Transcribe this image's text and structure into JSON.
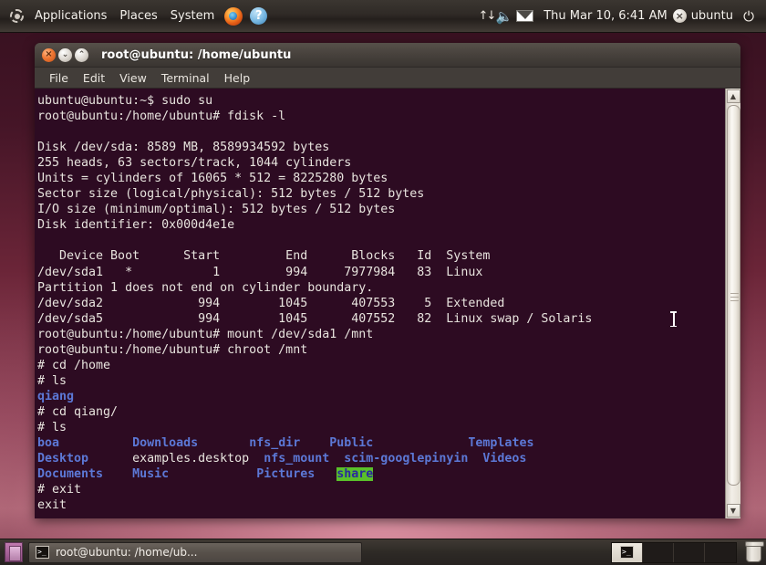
{
  "top_panel": {
    "logo_icon": "ubuntu-logo-icon",
    "menus": [
      "Applications",
      "Places",
      "System"
    ],
    "launchers": [
      {
        "icon": "firefox-icon",
        "label": "Firefox"
      },
      {
        "icon": "help-icon",
        "label": "?"
      }
    ],
    "tray": {
      "network_icon": "network-up-down-icon",
      "volume_icon": "volume-icon",
      "mail_icon": "mail-envelope-icon",
      "clock": "Thu Mar 10,  6:41 AM",
      "user_icon": "user-status-icon",
      "username": "ubuntu",
      "power_icon": "power-icon"
    }
  },
  "window": {
    "title": "root@ubuntu: /home/ubuntu",
    "buttons": {
      "close": "×",
      "minimize": "⌄",
      "maximize": "⌃"
    },
    "menubar": [
      "File",
      "Edit",
      "View",
      "Terminal",
      "Help"
    ]
  },
  "terminal": {
    "lines": [
      [
        {
          "t": "ubuntu@ubuntu:~$ sudo su"
        }
      ],
      [
        {
          "t": "root@ubuntu:/home/ubuntu# fdisk -l"
        }
      ],
      [
        {
          "t": ""
        }
      ],
      [
        {
          "t": "Disk /dev/sda: 8589 MB, 8589934592 bytes"
        }
      ],
      [
        {
          "t": "255 heads, 63 sectors/track, 1044 cylinders"
        }
      ],
      [
        {
          "t": "Units = cylinders of 16065 * 512 = 8225280 bytes"
        }
      ],
      [
        {
          "t": "Sector size (logical/physical): 512 bytes / 512 bytes"
        }
      ],
      [
        {
          "t": "I/O size (minimum/optimal): 512 bytes / 512 bytes"
        }
      ],
      [
        {
          "t": "Disk identifier: 0x000d4e1e"
        }
      ],
      [
        {
          "t": ""
        }
      ],
      [
        {
          "t": "   Device Boot      Start         End      Blocks   Id  System"
        }
      ],
      [
        {
          "t": "/dev/sda1   *           1         994     7977984   83  Linux"
        }
      ],
      [
        {
          "t": "Partition 1 does not end on cylinder boundary."
        }
      ],
      [
        {
          "t": "/dev/sda2             994        1045      407553    5  Extended"
        }
      ],
      [
        {
          "t": "/dev/sda5             994        1045      407552   82  Linux swap / Solaris"
        }
      ],
      [
        {
          "t": "root@ubuntu:/home/ubuntu# mount /dev/sda1 /mnt"
        }
      ],
      [
        {
          "t": "root@ubuntu:/home/ubuntu# chroot /mnt"
        }
      ],
      [
        {
          "t": "# cd /home"
        }
      ],
      [
        {
          "t": "# ls"
        }
      ],
      [
        {
          "t": "qiang",
          "c": "dir"
        }
      ],
      [
        {
          "t": "# cd qiang/"
        }
      ],
      [
        {
          "t": "# ls"
        }
      ],
      [
        {
          "t": "boa",
          "c": "dir"
        },
        {
          "t": "          "
        },
        {
          "t": "Downloads",
          "c": "dir"
        },
        {
          "t": "       "
        },
        {
          "t": "nfs_dir",
          "c": "dir"
        },
        {
          "t": "    "
        },
        {
          "t": "Public",
          "c": "dir"
        },
        {
          "t": "             "
        },
        {
          "t": "Templates",
          "c": "dir"
        }
      ],
      [
        {
          "t": "Desktop",
          "c": "dir"
        },
        {
          "t": "      "
        },
        {
          "t": "examples.desktop  "
        },
        {
          "t": "nfs_mount",
          "c": "dir"
        },
        {
          "t": "  "
        },
        {
          "t": "scim-googlepinyin",
          "c": "dir"
        },
        {
          "t": "  "
        },
        {
          "t": "Videos",
          "c": "dir"
        }
      ],
      [
        {
          "t": "Documents",
          "c": "dir"
        },
        {
          "t": "    "
        },
        {
          "t": "Music",
          "c": "dir"
        },
        {
          "t": "            "
        },
        {
          "t": "Pictures",
          "c": "dir"
        },
        {
          "t": "   "
        },
        {
          "t": "share",
          "c": "sticky"
        }
      ],
      [
        {
          "t": "# exit"
        }
      ],
      [
        {
          "t": "exit"
        }
      ]
    ],
    "scrollbar": {
      "up_arrow": "▲",
      "down_arrow": "▼"
    },
    "colors": {
      "background": "#2d0b22",
      "foreground": "#e8e4de",
      "directory": "#5c78d6",
      "sticky_bg": "#5ac02a",
      "sticky_fg": "#2a2a9e"
    }
  },
  "bottom_panel": {
    "show_desktop_icon": "show-desktop-icon",
    "task": {
      "icon": "terminal-icon",
      "label": "root@ubuntu: /home/ub..."
    },
    "workspaces": [
      {
        "active": true,
        "icon": "terminal-window-icon"
      },
      {
        "active": false,
        "icon": ""
      },
      {
        "active": false,
        "icon": ""
      },
      {
        "active": false,
        "icon": ""
      }
    ],
    "trash_icon": "trash-icon"
  }
}
